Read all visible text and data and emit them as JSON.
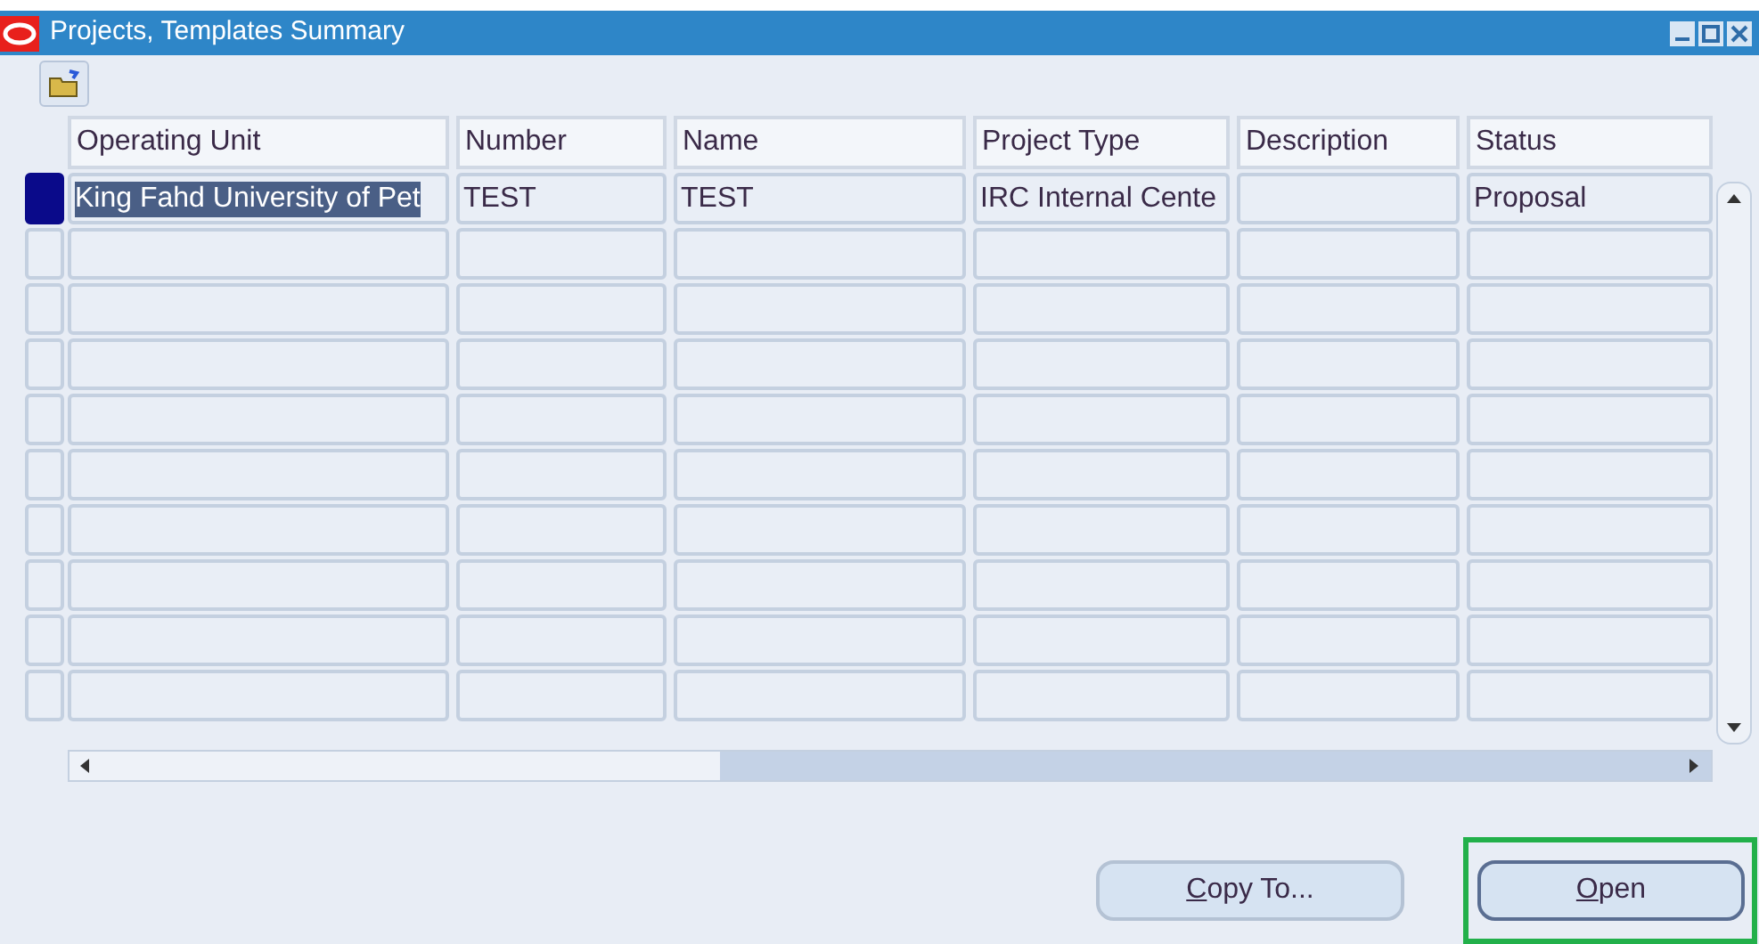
{
  "window": {
    "title": "Projects, Templates Summary"
  },
  "table": {
    "columns": [
      "Operating Unit",
      "Number",
      "Name",
      "Project Type",
      "Description",
      "Status"
    ],
    "rows": [
      {
        "selected": true,
        "cells": [
          "King Fahd University of Pet",
          "TEST",
          "TEST",
          "IRC Internal Cente",
          "",
          "Proposal"
        ]
      }
    ]
  },
  "buttons": [
    {
      "mnemonic": "C",
      "label_rest": "opy To...",
      "highlighted": false
    },
    {
      "mnemonic": "O",
      "label_rest": "pen",
      "highlighted": true
    }
  ]
}
